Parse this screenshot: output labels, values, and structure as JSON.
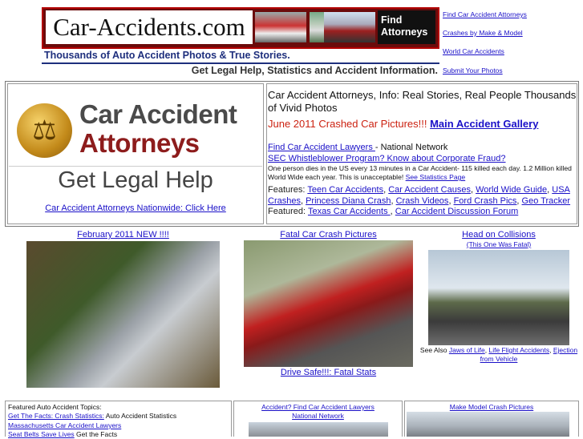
{
  "header": {
    "logo_text": "Car-Accidents.com",
    "find_box": "Find Attorneys",
    "tagline1": "Thousands of Auto Accident Photos & True Stories.",
    "tagline2": "Get Legal Help, Statistics and Accident Information."
  },
  "nav": {
    "links": [
      "Find Car Accident Attorneys",
      "Crashes by Make & Model",
      "World Car Accidents",
      "Submit Your Photos"
    ]
  },
  "attorney_panel": {
    "title_line1": "Car Accident",
    "title_line2": "Attorneys",
    "legal_help": "Get Legal Help",
    "link": "Car Accident Attorneys Nationwide: Click Here "
  },
  "info_panel": {
    "intro": "Car Accident Attorneys, Info: Real Stories, Real People Thousands of Vivid Photos",
    "june_text": "June 2011 Crashed Car Pictures!!! ",
    "main_gallery": "Main Accident Gallery",
    "find_lawyers": "Find Car Accident Lawyers ",
    "national_network": "- National Network",
    "sec": "SEC Whistleblower Program? Know about Corporate Fraud?",
    "one_person": "One person dies in the US every 13 minutes in a Car Accident- 115 killed each day. 1.2 Million killed World Wide each year. This is unacceptable! ",
    "stats_page": "See Statistics Page ",
    "features_label": "Features: ",
    "features": [
      "Teen Car Accidents",
      "Car Accident Causes",
      "World Wide Guide",
      "USA Crashes",
      "Princess Diana Crash",
      "Crash Videos",
      "Ford Crash Pics",
      "Geo Tracker "
    ],
    "featured_label": "Featured: ",
    "featured": [
      "Texas Car Accidents ",
      "Car Accident Discussion Forum"
    ]
  },
  "gallery": {
    "col1_caption": "February 2011 NEW !!!! ",
    "col2_caption": "Fatal Car Crash Pictures ",
    "col2_footer": "Drive Safe!!!: Fatal Stats ",
    "col3_caption": "Head on Collisions",
    "col3_sub": "(This One Was Fatal)",
    "see_also_label": "See Also ",
    "see_also": [
      "Jaws of Life",
      "Life Flight Accidents",
      "Ejection from Vehicle"
    ]
  },
  "bottom": {
    "box1_title": "Featured Auto Accident Topics:",
    "box1_l1_link": "Get The Facts: Crash Statistics:",
    "box1_l1_text": " Auto Accident Statistics",
    "box1_l2_link": "Massachusetts Car Accident Lawyers",
    "box1_l3_link": "Seat Belts Save Lives",
    "box1_l3_text": " Get the Facts",
    "box2_link1": "Accident? Find Car Accident Lawyers",
    "box2_link2": "National Network ",
    "box3_link": "Make Model Crash Pictures "
  }
}
